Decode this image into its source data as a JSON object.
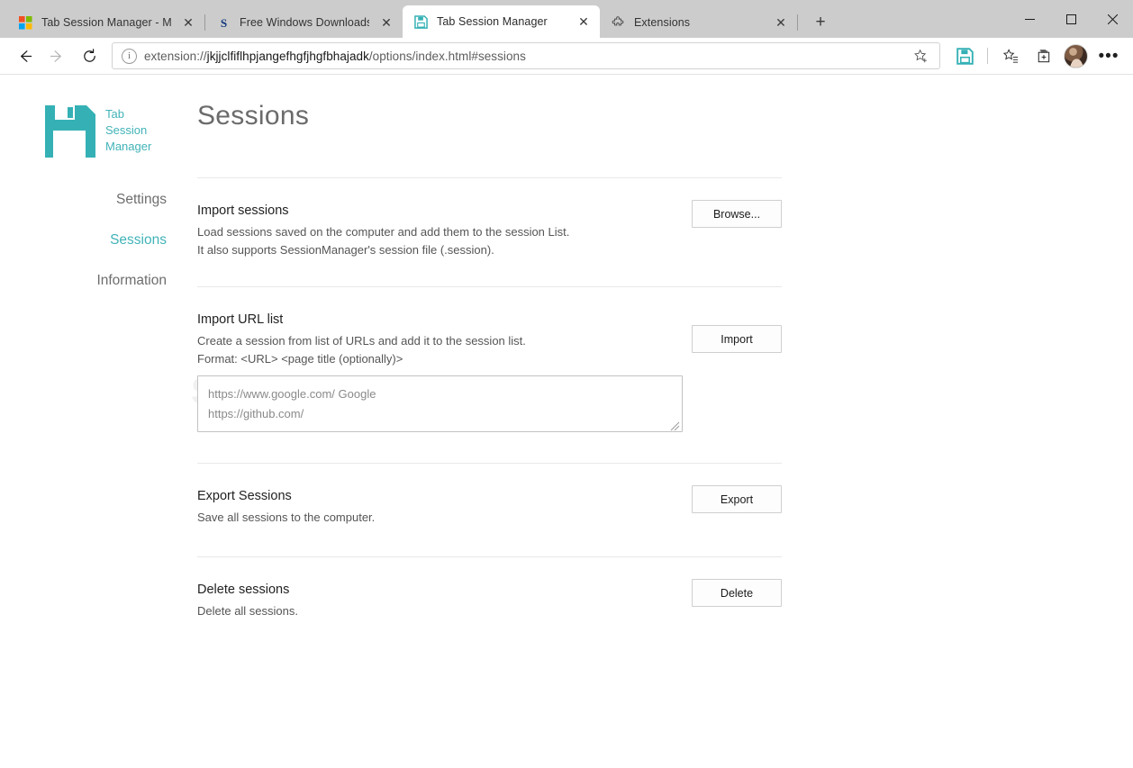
{
  "window": {
    "controls": {
      "minimize": "—",
      "maximize": "☐",
      "close": "✕"
    }
  },
  "tabs": [
    {
      "title": "Tab Session Manager - Microsoft",
      "favicon": "microsoft-logo-icon",
      "active": false,
      "close_label": "✕"
    },
    {
      "title": "Free Windows Downloads",
      "favicon": "softpedia-s-icon",
      "active": false,
      "close_label": "✕"
    },
    {
      "title": "Tab Session Manager",
      "favicon": "floppy-disk-icon",
      "active": true,
      "close_label": "✕"
    },
    {
      "title": "Extensions",
      "favicon": "puzzle-piece-icon",
      "active": false,
      "close_label": "✕"
    }
  ],
  "newtab_label": "+",
  "toolbar": {
    "back_icon": "back-arrow-icon",
    "forward_icon": "forward-arrow-icon",
    "refresh_icon": "refresh-icon",
    "info_icon_label": "i",
    "url_prefix": "extension://",
    "url_host": "jkjjclfiflhpjangefhgfjhgfbhajadk",
    "url_suffix": "/options/index.html#sessions",
    "favorite_icon": "star-add-icon",
    "extension_icon": "floppy-disk-extension-icon",
    "favorites_icon": "favorites-list-icon",
    "collections_icon": "collections-icon",
    "profile_icon": "profile-avatar",
    "settings_icon": "ellipsis-icon",
    "settings_label": "•••"
  },
  "watermark": "SOFTPEDIA",
  "sidebar": {
    "logo_icon": "floppy-disk-logo-icon",
    "brand_lines": [
      "Tab",
      "Session",
      "Manager"
    ],
    "items": [
      {
        "label": "Settings",
        "active": false
      },
      {
        "label": "Sessions",
        "active": true
      },
      {
        "label": "Information",
        "active": false
      }
    ]
  },
  "main": {
    "page_title": "Sessions",
    "sections": [
      {
        "title": "Import sessions",
        "desc_lines": [
          "Load sessions saved on the computer and add them to the session List.",
          "It also supports SessionManager's session file (.session)."
        ],
        "button": "Browse..."
      },
      {
        "title": "Import URL list",
        "desc_lines": [
          "Create a session from list of URLs and add it to the session list.",
          "Format: <URL>  <page title (optionally)>"
        ],
        "button": "Import",
        "textarea_lines": [
          "https://www.google.com/ Google",
          "https://github.com/"
        ]
      },
      {
        "title": "Export Sessions",
        "desc_lines": [
          "Save all sessions to the computer."
        ],
        "button": "Export"
      },
      {
        "title": "Delete sessions",
        "desc_lines": [
          "Delete all sessions."
        ],
        "button": "Delete"
      }
    ]
  },
  "colors": {
    "accent_teal": "#42b3b8",
    "chrome_gray": "#cccccc"
  }
}
